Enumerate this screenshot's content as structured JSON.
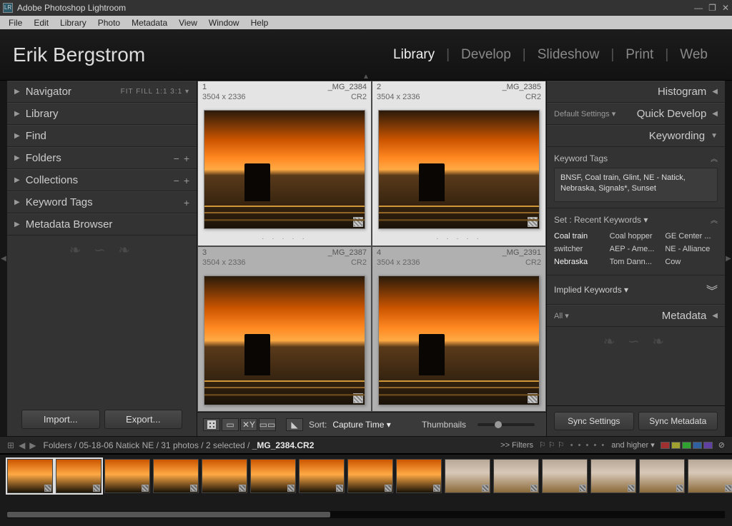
{
  "titleBar": {
    "title": "Adobe Photoshop Lightroom",
    "logo": "LR"
  },
  "menu": [
    "File",
    "Edit",
    "Library",
    "Photo",
    "Metadata",
    "View",
    "Window",
    "Help"
  ],
  "identity": {
    "user": "Erik Bergstrom"
  },
  "modules": [
    "Library",
    "Develop",
    "Slideshow",
    "Print",
    "Web"
  ],
  "activeModule": "Library",
  "leftPanels": {
    "navigator": {
      "label": "Navigator",
      "aux": "FIT  FILL  1:1  3:1 ▾"
    },
    "library": {
      "label": "Library"
    },
    "find": {
      "label": "Find"
    },
    "folders": {
      "label": "Folders"
    },
    "collections": {
      "label": "Collections"
    },
    "keywordTags": {
      "label": "Keyword Tags"
    },
    "metadataBrowser": {
      "label": "Metadata Browser"
    }
  },
  "importBtn": "Import...",
  "exportBtn": "Export...",
  "rightPanels": {
    "histogram": {
      "label": "Histogram"
    },
    "quickDevelop": {
      "label": "Quick Develop",
      "preset": "Default Settings ▾"
    },
    "keywording": {
      "label": "Keywording"
    },
    "metadata": {
      "label": "Metadata",
      "preset": "All ▾"
    }
  },
  "keywording": {
    "tagsTitle": "Keyword Tags",
    "tags": "BNSF, Coal train, Glint, NE - Natick, Nebraska, Signals*, Sunset",
    "setLabel": "Set :  Recent Keywords ▾",
    "recent": [
      {
        "t": "Coal train",
        "sel": true
      },
      {
        "t": "Coal hopper"
      },
      {
        "t": "GE Center ..."
      },
      {
        "t": "switcher"
      },
      {
        "t": "AEP - Ame..."
      },
      {
        "t": "NE - Alliance"
      },
      {
        "t": "Nebraska",
        "sel": true
      },
      {
        "t": "Tom Dann..."
      },
      {
        "t": "Cow"
      }
    ],
    "impliedTitle": "Implied Keywords ▾"
  },
  "syncSettings": "Sync Settings",
  "syncMetadata": "Sync Metadata",
  "gridCells": [
    {
      "idx": "1",
      "name": "_MG_2384",
      "dims": "3504 x 2336",
      "fmt": "CR2",
      "selected": true
    },
    {
      "idx": "2",
      "name": "_MG_2385",
      "dims": "3504 x 2336",
      "fmt": "CR2",
      "selected": true
    },
    {
      "idx": "3",
      "name": "_MG_2387",
      "dims": "3504 x 2336",
      "fmt": "CR2",
      "selected": false
    },
    {
      "idx": "4",
      "name": "_MG_2391",
      "dims": "3504 x 2336",
      "fmt": "CR2",
      "selected": false
    }
  ],
  "toolbar": {
    "sortLabel": "Sort:",
    "sortValue": "Capture Time ▾",
    "thumbLabel": "Thumbnails"
  },
  "breadcrumb": {
    "path": "Folders / 05-18-06 Natick NE / 31 photos / 2 selected / ",
    "current": "_MG_2384.CR2",
    "filtersLabel": ">> Filters",
    "ratingLabel": "and higher ▾"
  },
  "swatches": [
    "#a03030",
    "#a0a030",
    "#30a030",
    "#3060a0",
    "#6040a0"
  ],
  "filmstripCount": 15,
  "filmstripSelected": [
    0,
    1
  ],
  "filmstripAltStart": 9
}
